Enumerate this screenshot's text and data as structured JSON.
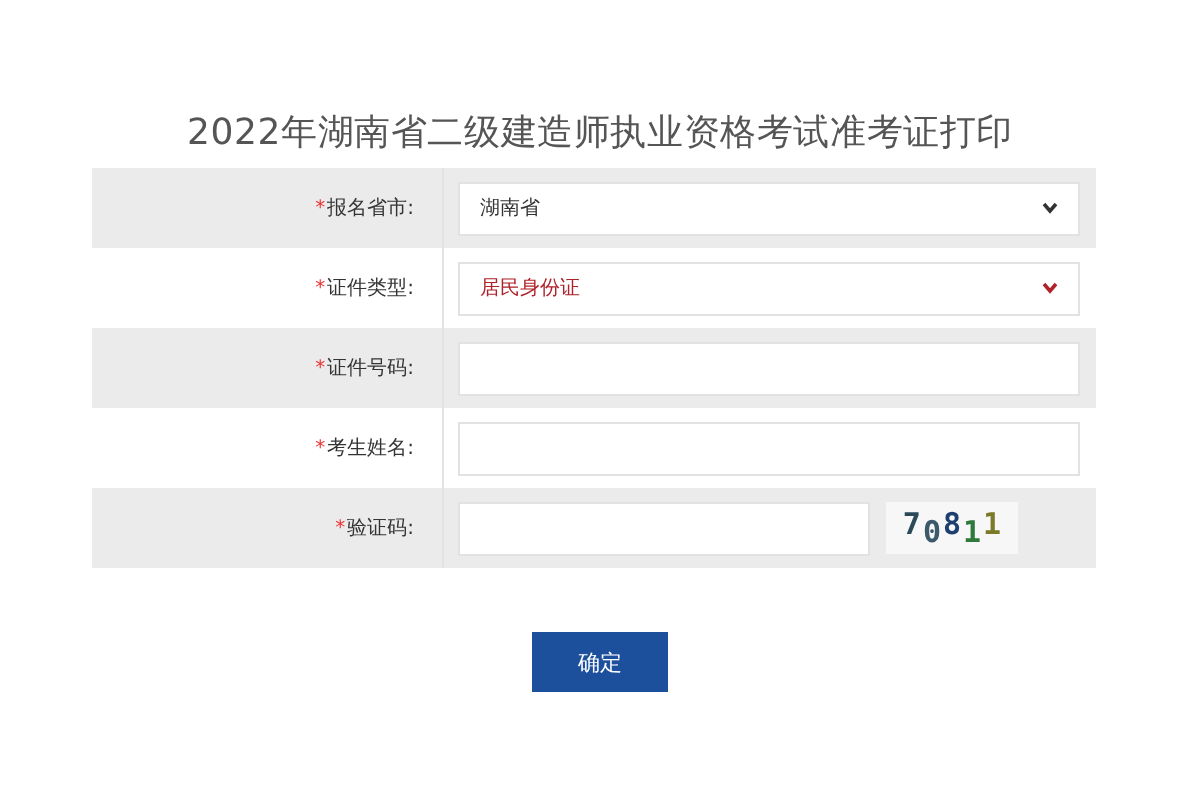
{
  "title": "2022年湖南省二级建造师执业资格考试准考证打印",
  "rows": [
    {
      "kind": "select",
      "required_mark": "*",
      "label": "报名省市:",
      "value": "湖南省",
      "color": "#333333"
    },
    {
      "kind": "select",
      "required_mark": "*",
      "label": "证件类型:",
      "value": "居民身份证",
      "color": "#b0222a"
    },
    {
      "kind": "input",
      "required_mark": "*",
      "label": "证件号码:"
    },
    {
      "kind": "input",
      "required_mark": "*",
      "label": "考生姓名:"
    },
    {
      "kind": "captcha",
      "required_mark": "*",
      "label": "验证码:",
      "captcha": "70811"
    }
  ],
  "submit": "确定"
}
